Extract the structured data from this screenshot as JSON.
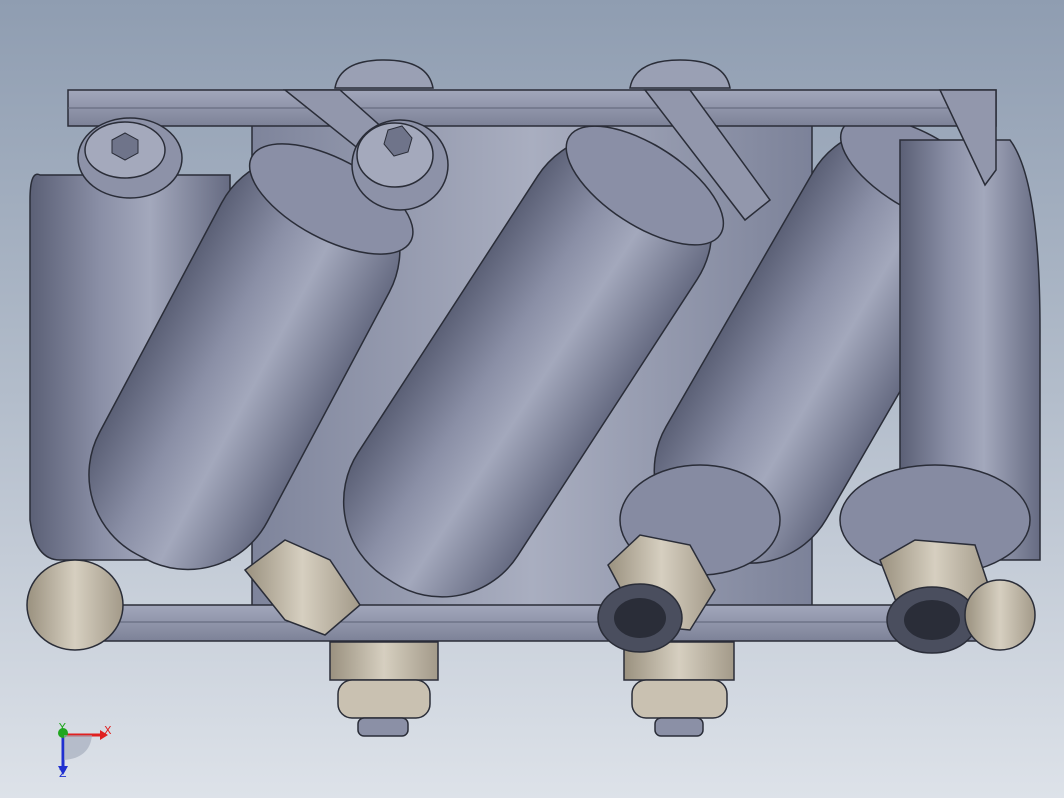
{
  "viewport": {
    "background_top": "#8f9db1",
    "background_bottom": "#dde2e9",
    "model": "mecanum-wheel-assembly",
    "view": "front"
  },
  "colors": {
    "roller": "#7e849c",
    "roller_light": "#a3a8bc",
    "roller_dark": "#5b6076",
    "frame": "#8b90a6",
    "nut": "#c7bfaf",
    "nut_dark": "#948b7c",
    "edge": "#2a2d38"
  },
  "triad": {
    "x_label": "X",
    "y_label": "Y",
    "z_label": "Z",
    "x_color": "#e02020",
    "y_color": "#1fa61f",
    "z_color": "#2030d0"
  }
}
